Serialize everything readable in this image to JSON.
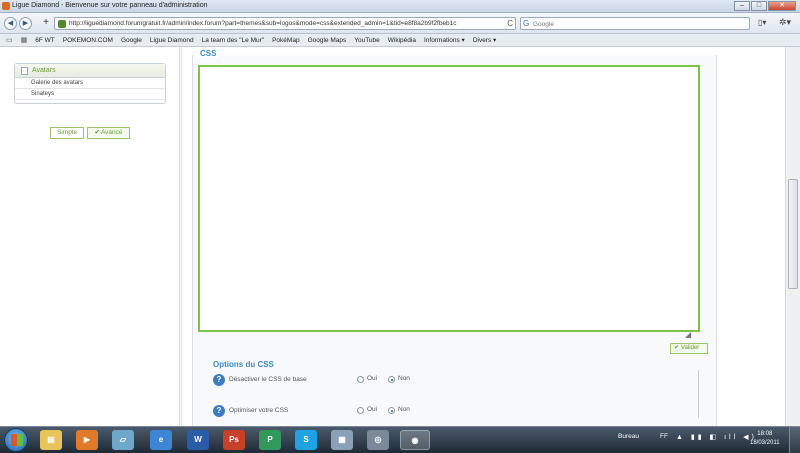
{
  "window": {
    "title": "Ligue Diamond - Bienvenue sur votre panneau d'administration",
    "min": "–",
    "max": "□",
    "close": "✕"
  },
  "nav": {
    "back": "◀",
    "forward": "▶",
    "add": "+",
    "url": "http://liguediamond.forumgratuit.fr/admin/index.forum?part=themes&sub=logos&mode=css&extended_admin=1&tid=e8f8a2b9f2fbeb1c",
    "reload": "C",
    "search_placeholder": "Google",
    "page_menu": "▯▾",
    "tools_menu": "✲▾"
  },
  "bookmarks": [
    "6F WT",
    "POKEMON.COM",
    "Google",
    "Ligue Diamond",
    "La team des \"Le Mur\"",
    "PokéMap",
    "Google Maps",
    "YouTube",
    "Wikipédia",
    "Informations ▾",
    "Divers ▾"
  ],
  "sidebar": {
    "section_title": "Avatars",
    "items": [
      "Galerie des avatars",
      "Sinateys"
    ],
    "mode_simple": "Simple",
    "mode_advanced": "Avancé"
  },
  "editor": {
    "title": "CSS",
    "textarea_value": "",
    "validate": "Valider"
  },
  "options": {
    "title": "Options du CSS",
    "rows": [
      {
        "question": "Désactiver le CSS de base",
        "opt1": "Oui",
        "opt2": "Non",
        "selected": "Non"
      },
      {
        "question": "Optimiser votre CSS",
        "opt1": "Oui",
        "opt2": "Non",
        "selected": "Non"
      }
    ]
  },
  "taskbar": {
    "apps": [
      "explorer",
      "media-player",
      "folder",
      "internet-explorer",
      "word",
      "photoshop",
      "publisher",
      "skype",
      "calculator",
      "disk",
      "firefox"
    ],
    "desktop_label": "Bureau",
    "lang": "FF",
    "time": "18:08",
    "date": "18/03/2011"
  },
  "colors": {
    "accent_green": "#7cc34a",
    "title_blue": "#3f8bc0",
    "help_blue": "#3b7cc4"
  }
}
